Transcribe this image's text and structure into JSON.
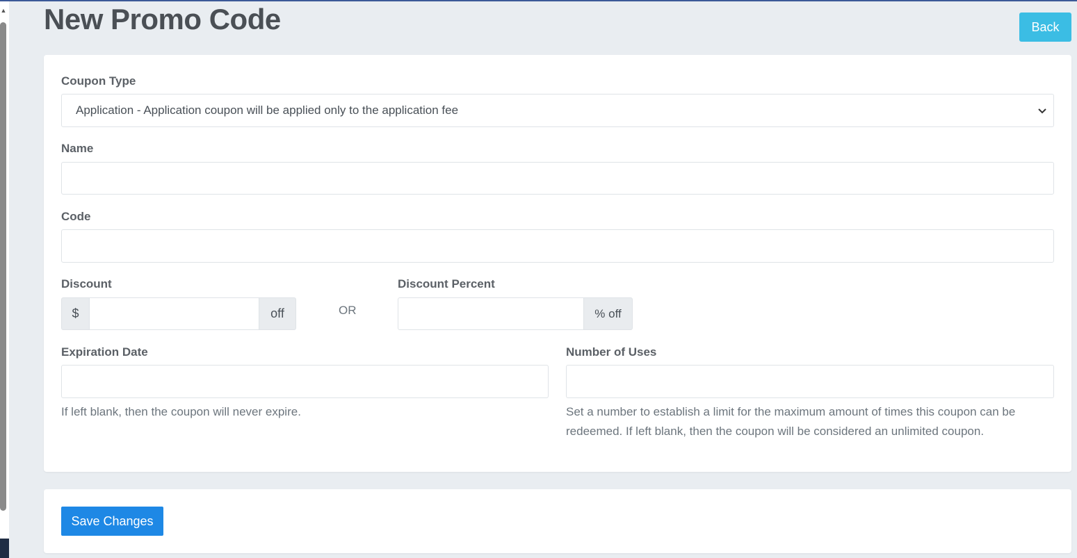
{
  "page": {
    "title": "New Promo Code",
    "back_label": "Back"
  },
  "form": {
    "coupon_type": {
      "label": "Coupon Type",
      "selected": "Application - Application coupon will be applied only to the application fee"
    },
    "name": {
      "label": "Name",
      "value": ""
    },
    "code": {
      "label": "Code",
      "value": ""
    },
    "discount": {
      "label": "Discount",
      "prefix": "$",
      "suffix": "off",
      "value": ""
    },
    "or_label": "OR",
    "discount_percent": {
      "label": "Discount Percent",
      "suffix": "% off",
      "value": ""
    },
    "expiration_date": {
      "label": "Expiration Date",
      "value": "",
      "help": "If left blank, then the coupon will never expire."
    },
    "number_of_uses": {
      "label": "Number of Uses",
      "value": "",
      "help_line1": "Set a number to establish a limit for the maximum amount of times this coupon can be",
      "help_line2": "redeemed. If left blank, then the coupon will be considered an unlimited coupon."
    }
  },
  "footer": {
    "save_label": "Save Changes"
  },
  "colors": {
    "back_button": "#3bbde4",
    "save_button": "#1e88e5",
    "page_background": "#e9edf1"
  },
  "icons": {
    "select_chevron": "chevron-down-icon",
    "scroll_up": "caret-up-icon"
  }
}
